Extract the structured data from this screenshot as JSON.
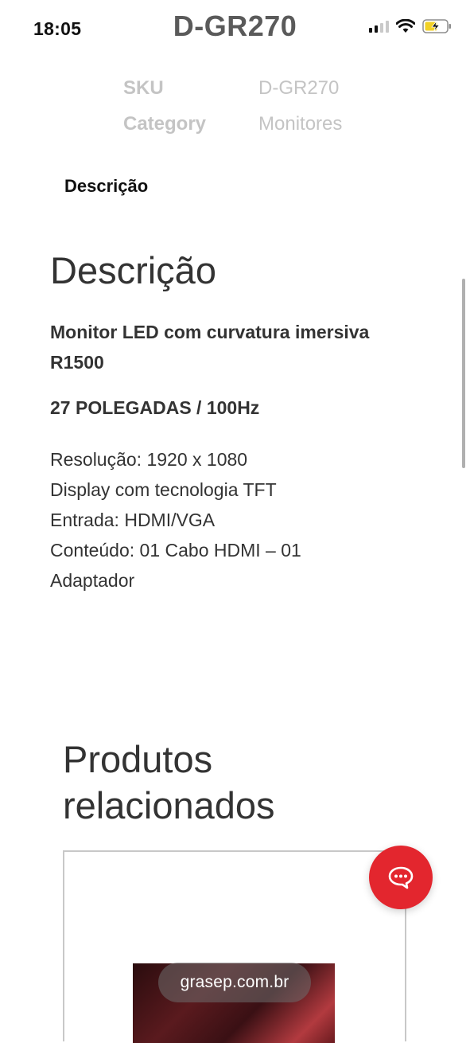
{
  "status_bar": {
    "time": "18:05",
    "icons": [
      "signal-icon",
      "wifi-icon",
      "battery-charging-icon"
    ],
    "battery_color": "#f2d125"
  },
  "header": {
    "title": "D-GR270"
  },
  "meta": {
    "rows": [
      {
        "key": "SKU",
        "value": "D-GR270"
      },
      {
        "key": "Category",
        "value": "Monitores"
      }
    ]
  },
  "tabs": {
    "active_label": "Descrição"
  },
  "description": {
    "heading": "Descrição",
    "subtitle": "Monitor LED com curvatura imersiva R1500",
    "highlight": "27 POLEGADAS / 100Hz",
    "specs": [
      "Resolução: 1920 x 1080",
      "Display com tecnologia TFT",
      "Entrada: HDMI/VGA",
      "Conteúdo: 01 Cabo HDMI – 01 Adaptador"
    ]
  },
  "related": {
    "heading": "Produtos relacionados"
  },
  "chat": {
    "icon": "chat-bubble-icon",
    "color": "#e3262e"
  },
  "browser": {
    "url": "grasep.com.br"
  }
}
